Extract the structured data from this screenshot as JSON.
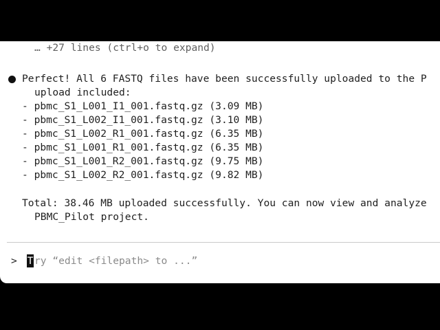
{
  "output": {
    "collapsed_text": "… +27 lines (ctrl+o to expand)",
    "message_line_1": "Perfect! All 6 FASTQ files have been successfully uploaded to the P",
    "message_line_2": "upload included:",
    "files": [
      "- pbmc_S1_L001_I1_001.fastq.gz (3.09 MB)",
      "- pbmc_S1_L002_I1_001.fastq.gz (3.10 MB)",
      "- pbmc_S1_L002_R1_001.fastq.gz (6.35 MB)",
      "- pbmc_S1_L001_R1_001.fastq.gz (6.35 MB)",
      "- pbmc_S1_L001_R2_001.fastq.gz (9.75 MB)",
      "- pbmc_S1_L002_R2_001.fastq.gz (9.82 MB)"
    ],
    "total_line_1": "Total: 38.46 MB uploaded successfully. You can now view and analyze",
    "total_line_2": "PBMC_Pilot project."
  },
  "input": {
    "prompt_symbol": ">",
    "placeholder_first_char": "T",
    "placeholder_rest": "ry “edit <filepath> to ...”"
  },
  "colors": {
    "background": "#000000",
    "terminal_bg": "#ffffff",
    "text": "#1f1f1f",
    "muted": "#8a8a8a",
    "divider": "#c9c9c9"
  }
}
